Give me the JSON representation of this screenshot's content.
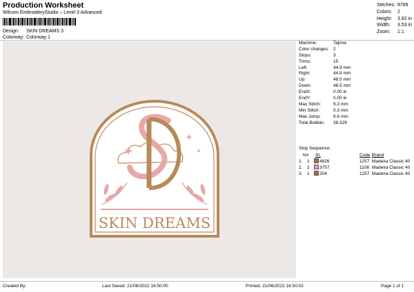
{
  "header": {
    "title": "Production Worksheet",
    "subtitle": "Wilcom EmbroideryStudio – Level 3 Advanced"
  },
  "meta": {
    "design_label": "Design:",
    "design_value": "SKIN DREAMS 3",
    "colorway_label": "Colorway:",
    "colorway_value": "Colorway 1"
  },
  "stats": [
    {
      "label": "Stitches:",
      "value": "8789"
    },
    {
      "label": "Colors:",
      "value": "2"
    },
    {
      "label": "Height:",
      "value": "3.82 in"
    },
    {
      "label": "Width:",
      "value": "3.53 in"
    },
    {
      "label": "Zoom:",
      "value": "1:1"
    }
  ],
  "design": {
    "text": "SKIN DREAMS",
    "colors": {
      "background": "#ebe8e6",
      "gold": "#b88a58",
      "pink": "#e6a8a8",
      "cloud": "#ffffff"
    }
  },
  "info": [
    {
      "label": "Machine:",
      "value": "Tajima"
    },
    {
      "label": "Color changes:",
      "value": "2"
    },
    {
      "label": "Stops:",
      "value": "3"
    },
    {
      "label": "Trims:",
      "value": "15"
    },
    {
      "label": "Left:",
      "value": "44.9 mm"
    },
    {
      "label": "Right:",
      "value": "44.9 mm"
    },
    {
      "label": "Up:",
      "value": "48.5 mm"
    },
    {
      "label": "Down:",
      "value": "48.5 mm"
    },
    {
      "label": "EndX:",
      "value": "0.00 in"
    },
    {
      "label": "EndY:",
      "value": "0.00 in"
    },
    {
      "label": "Max Stitch:",
      "value": "9.3 mm"
    },
    {
      "label": "Min Stitch:",
      "value": "0.3 mm"
    },
    {
      "label": "Max Jump:",
      "value": "6.6 mm"
    },
    {
      "label": "Total Bobbin:",
      "value": "38.32ft"
    }
  ],
  "stops": {
    "title": "Stop Sequence:",
    "headers": {
      "n": "N#",
      "st": "St.",
      "code": "Code",
      "brand": "Brand"
    },
    "rows": [
      {
        "idx": "1.",
        "n": "1",
        "color": "#b5693a",
        "st": "4826",
        "code": "1257",
        "brand": "Madeira Classic 40"
      },
      {
        "idx": "2.",
        "n": "2",
        "color": "#e8a0a4",
        "st": "3757",
        "code": "1108",
        "brand": "Madeira Classic 40"
      },
      {
        "idx": "3.",
        "n": "1",
        "color": "#b5693a",
        "st": "204",
        "code": "1257",
        "brand": "Madeira Classic 40"
      }
    ]
  },
  "footer": {
    "created": "Created By:",
    "saved": "Last Saved: 21/06/2022 16:50:00",
    "printed": "Printed: 21/06/2022 16:50:02",
    "page": "Page 1 of 1"
  }
}
